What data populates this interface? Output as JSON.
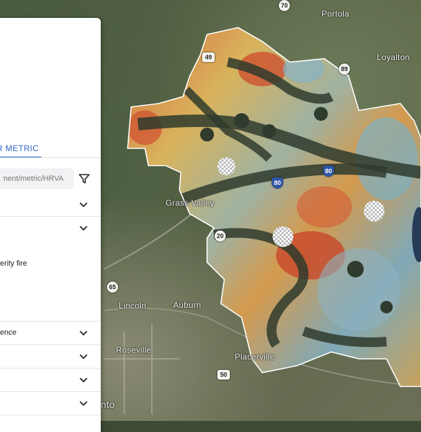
{
  "panel": {
    "tab_label": "R METRIC",
    "search": {
      "placeholder": "ment/metric/HRVA"
    },
    "description": "erity fire",
    "rows": [
      {
        "label": ""
      },
      {
        "label": ""
      },
      {
        "label": "ence"
      },
      {
        "label": ""
      },
      {
        "label": ""
      },
      {
        "label": ""
      }
    ]
  },
  "map": {
    "places": [
      {
        "name": "Portola"
      },
      {
        "name": "Loyalton"
      },
      {
        "name": "Lincoln"
      },
      {
        "name": "Auburn"
      },
      {
        "name": "Roseville"
      },
      {
        "name": "Placerville"
      },
      {
        "name": "Grass Valley"
      },
      {
        "name": "nto"
      }
    ],
    "shields": [
      {
        "number": "70"
      },
      {
        "number": "89"
      },
      {
        "number": "49"
      },
      {
        "number": "80"
      },
      {
        "number": "65"
      },
      {
        "number": "50"
      },
      {
        "number": "20"
      },
      {
        "number": "80"
      }
    ]
  }
}
